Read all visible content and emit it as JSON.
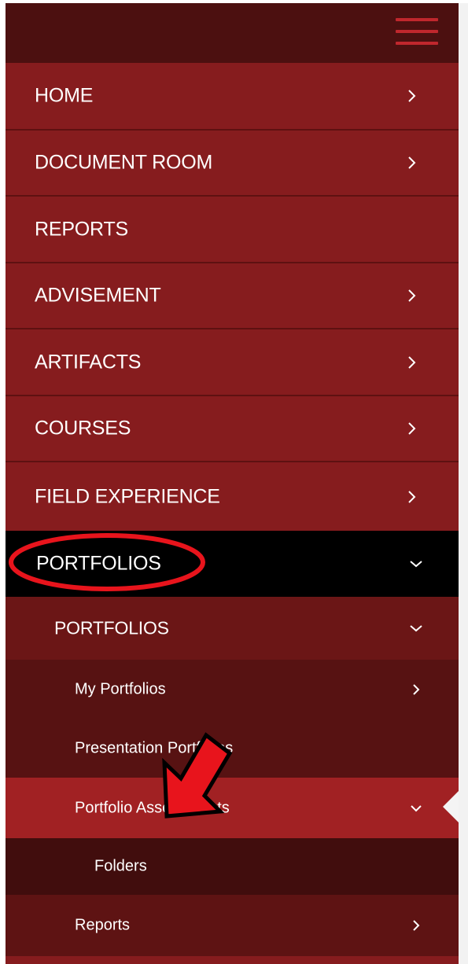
{
  "nav": {
    "menu_icon": "hamburger-menu-icon",
    "items": [
      {
        "label": "HOME",
        "icon": "chevron-right-icon"
      },
      {
        "label": "DOCUMENT ROOM",
        "icon": "chevron-right-icon"
      },
      {
        "label": "REPORTS"
      },
      {
        "label": "ADVISEMENT",
        "icon": "chevron-right-icon"
      },
      {
        "label": "ARTIFACTS",
        "icon": "chevron-right-icon"
      },
      {
        "label": "COURSES",
        "icon": "chevron-right-icon"
      },
      {
        "label": "FIELD EXPERIENCE",
        "icon": "chevron-right-icon"
      },
      {
        "label": "PORTFOLIOS",
        "icon": "chevron-down-icon"
      }
    ],
    "sub": {
      "label": "PORTFOLIOS",
      "icon": "chevron-down-icon",
      "children": [
        {
          "label": "My Portfolios",
          "icon": "chevron-right-icon"
        },
        {
          "label": "Presentation Portfolios"
        },
        {
          "label": "Portfolio Assessments",
          "icon": "chevron-down-icon"
        },
        {
          "label": "Folders"
        },
        {
          "label": "Reports",
          "icon": "chevron-right-icon"
        }
      ]
    }
  },
  "colors": {
    "menu_bg": "#861c1e",
    "topbar_bg": "#4c1010",
    "active_bg": "#000000",
    "highlight_bg": "#a12123",
    "annotation": "#e8141c"
  },
  "annotations": {
    "ellipse_target": "PORTFOLIOS",
    "arrow_target": "Portfolio Assessments",
    "arrow_icon": "red-arrow-icon",
    "ellipse_icon": "red-ellipse-highlight-icon"
  }
}
